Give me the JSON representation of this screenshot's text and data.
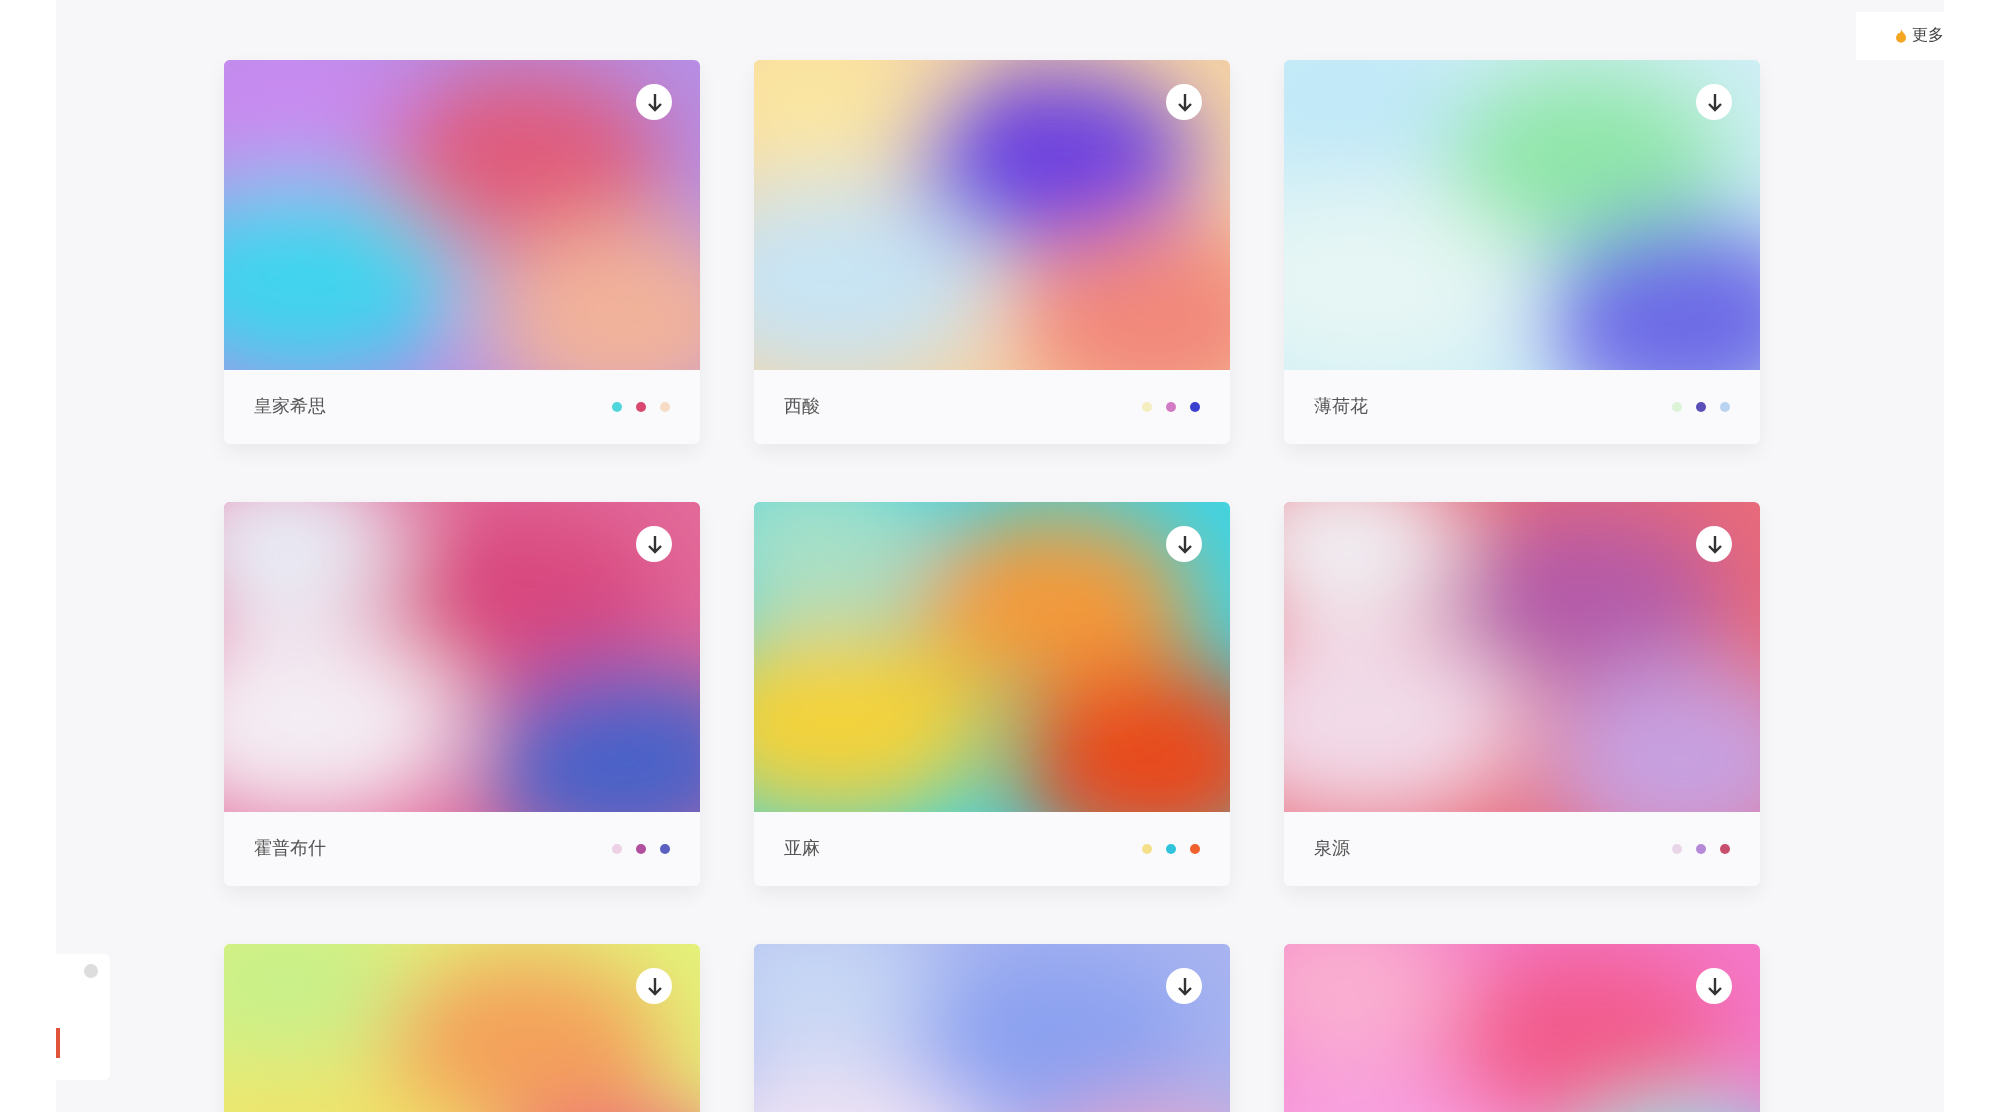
{
  "more_button": {
    "label": "更多"
  },
  "cards": [
    {
      "kind": "gradient",
      "name": "皇家希思",
      "dots": [
        {
          "color": "#4fd6dc"
        },
        {
          "color": "#d9486e"
        },
        {
          "color": "#f6dcc4"
        }
      ]
    },
    {
      "kind": "gradient",
      "name": "西酸",
      "dots": [
        {
          "color": "#f5eec0"
        },
        {
          "color": "#d27ac4"
        },
        {
          "color": "#3b3fd0"
        }
      ]
    },
    {
      "kind": "gradient",
      "name": "薄荷花",
      "dots": [
        {
          "color": "#dcf3d8"
        },
        {
          "color": "#5a4fb8"
        },
        {
          "color": "#b9d3f0"
        }
      ]
    },
    {
      "kind": "gradient",
      "name": "霍普布什",
      "dots": [
        {
          "color": "#ecd2e4"
        },
        {
          "color": "#b0509e"
        },
        {
          "color": "#5b5fc0"
        }
      ]
    },
    {
      "kind": "gradient",
      "name": "亚麻",
      "dots": [
        {
          "color": "#f6df8a"
        },
        {
          "color": "#2fc4dc"
        },
        {
          "color": "#f0602c"
        }
      ]
    },
    {
      "kind": "gradient",
      "name": "泉源",
      "dots": [
        {
          "color": "#e8d6e8"
        },
        {
          "color": "#b688d8"
        },
        {
          "color": "#c84e6e"
        }
      ]
    },
    {
      "kind": "picture"
    },
    {
      "kind": "picture"
    },
    {
      "kind": "picture"
    }
  ]
}
